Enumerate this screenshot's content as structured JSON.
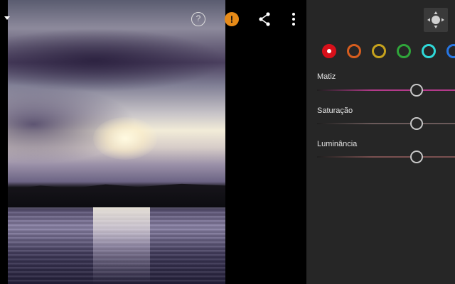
{
  "toolbar": {
    "help_glyph": "?",
    "warning_glyph": "!",
    "icons": [
      "menu-caret-icon",
      "help-icon",
      "warning-icon",
      "share-icon",
      "more-vert-icon",
      "target-adjust-icon"
    ],
    "warning_color": "#e68a18"
  },
  "hsl_panel": {
    "swatches": [
      {
        "name": "red",
        "color": "#d8101a",
        "selected": true
      },
      {
        "name": "orange",
        "color": "#d65d1e",
        "selected": false
      },
      {
        "name": "yellow",
        "color": "#c6a21d",
        "selected": false
      },
      {
        "name": "green",
        "color": "#2fa53a",
        "selected": false
      },
      {
        "name": "aqua",
        "color": "#2fd9d9",
        "selected": false
      },
      {
        "name": "blue",
        "color": "#2677e6",
        "selected": false
      }
    ],
    "sliders": [
      {
        "label": "Matiz",
        "value_fraction": 0.72,
        "track_color": "#b33a8a"
      },
      {
        "label": "Saturação",
        "value_fraction": 0.72,
        "track_color": "#6b5a5a"
      },
      {
        "label": "Luminância",
        "value_fraction": 0.72,
        "track_color": "#7a5050"
      }
    ]
  }
}
